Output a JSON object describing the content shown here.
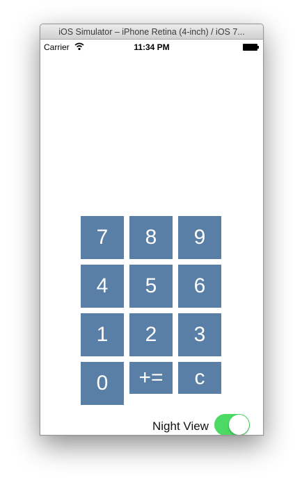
{
  "window": {
    "title": "iOS Simulator – iPhone Retina (4-inch) / iOS 7..."
  },
  "status_bar": {
    "carrier": "Carrier",
    "time": "11:34 PM",
    "wifi_icon": "wifi-icon",
    "battery_icon": "battery-icon"
  },
  "keypad": {
    "keys": [
      "7",
      "8",
      "9",
      "4",
      "5",
      "6",
      "1",
      "2",
      "3",
      "0",
      "+=",
      "c"
    ],
    "key_color": "#5a7fa6",
    "text_color": "#ffffff"
  },
  "night_view": {
    "label": "Night View",
    "on": true,
    "on_color": "#4cd964"
  }
}
